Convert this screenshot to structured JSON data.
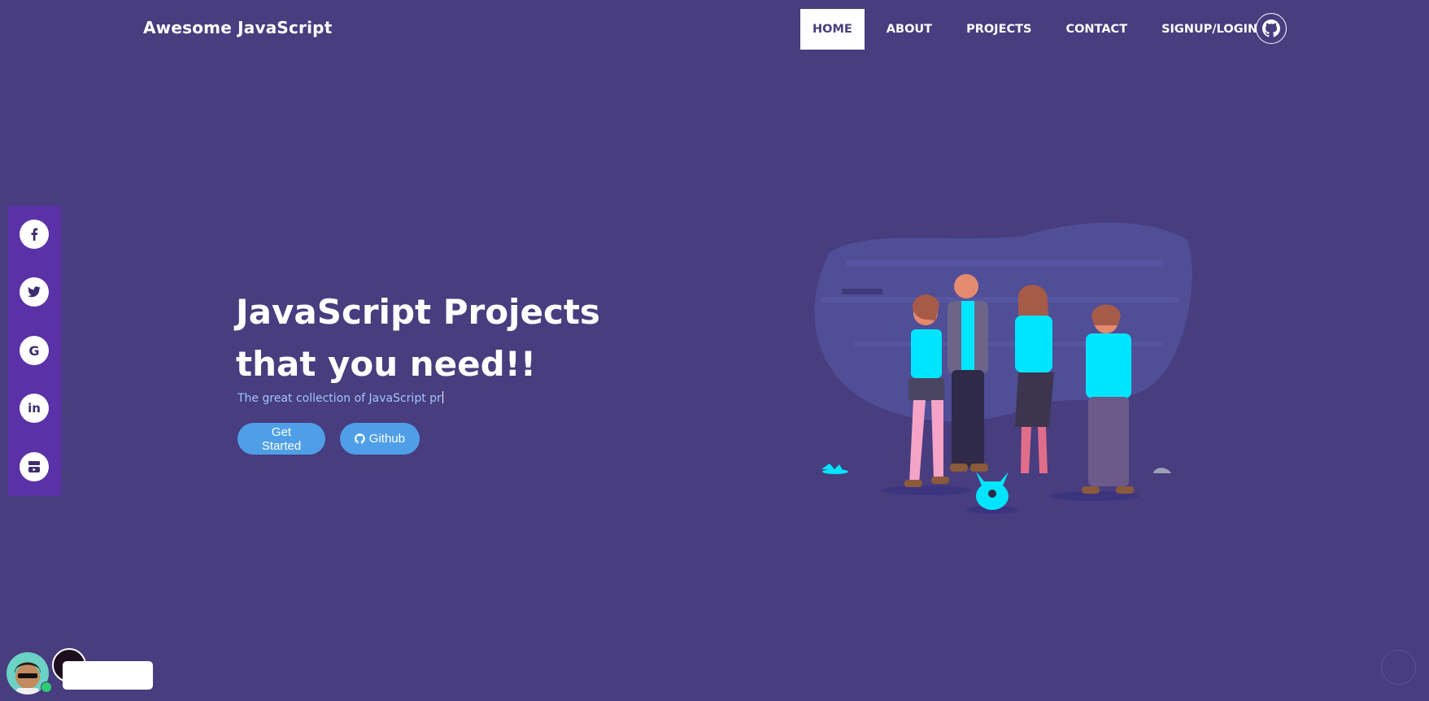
{
  "brand": "Awesome JavaScript",
  "nav": {
    "items": [
      {
        "label": "HOME",
        "active": true
      },
      {
        "label": "ABOUT",
        "active": false
      },
      {
        "label": "PROJECTS",
        "active": false
      },
      {
        "label": "CONTACT",
        "active": false
      },
      {
        "label": "SIGNUP/LOGIN",
        "active": false
      }
    ],
    "github_icon": "github-icon"
  },
  "social": [
    "facebook-icon",
    "twitter-icon",
    "google-icon",
    "linkedin-icon",
    "youtube-icon"
  ],
  "hero": {
    "title_line1": "JavaScript Projects",
    "title_line2": "that you need!!",
    "subtitle_typed": "The great collection of JavaScript pr",
    "get_started_label": "Get Started",
    "github_label": "Github"
  },
  "colors": {
    "background": "#483d7e",
    "social_bar": "#5a31a6",
    "button": "#4e9fe8",
    "subtitle": "#9fc6ff",
    "accent_cyan": "#00e5ff"
  }
}
